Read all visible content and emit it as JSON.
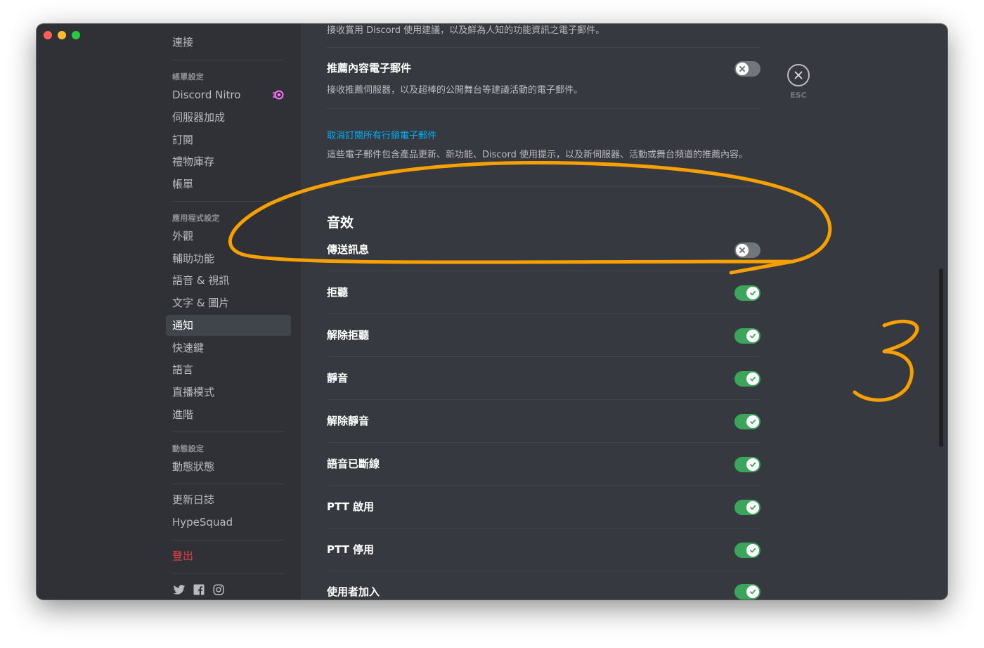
{
  "sidebar": {
    "items": [
      {
        "id": "connections",
        "label": "連接"
      },
      {
        "id": "nitro",
        "label": "Discord Nitro"
      },
      {
        "id": "server-boost",
        "label": "伺服器加成"
      },
      {
        "id": "subscriptions",
        "label": "訂閱"
      },
      {
        "id": "gift-inventory",
        "label": "禮物庫存"
      },
      {
        "id": "billing",
        "label": "帳單"
      },
      {
        "id": "appearance",
        "label": "外觀"
      },
      {
        "id": "accessibility",
        "label": "輔助功能"
      },
      {
        "id": "voice-video",
        "label": "語音 & 視訊"
      },
      {
        "id": "text-images",
        "label": "文字 & 圖片"
      },
      {
        "id": "notifications",
        "label": "通知"
      },
      {
        "id": "keybinds",
        "label": "快速鍵"
      },
      {
        "id": "language",
        "label": "語言"
      },
      {
        "id": "streamer-mode",
        "label": "直播模式"
      },
      {
        "id": "advanced",
        "label": "進階"
      },
      {
        "id": "activity-status",
        "label": "動態狀態"
      },
      {
        "id": "changelog",
        "label": "更新日誌"
      },
      {
        "id": "hypesquad",
        "label": "HypeSquad"
      },
      {
        "id": "logout",
        "label": "登出"
      }
    ],
    "headers": {
      "billing": "帳單設定",
      "app": "應用程式設定",
      "activity": "動態設定"
    },
    "selected": "notifications",
    "social_icons": [
      "twitter-icon",
      "facebook-icon",
      "instagram-icon"
    ]
  },
  "content": {
    "top_text": "接收賞用 Discord 使用建議，以及鮮為人知的功能資訊之電子郵件。",
    "recommendation": {
      "title": "推薦內容電子郵件",
      "desc": "接收推薦伺服器，以及超棒的公開舞台等建議活動的電子郵件。",
      "enabled": false
    },
    "unsubscribe": {
      "link": "取消訂閱所有行銷電子郵件",
      "desc": "這些電子郵件包含產品更新、新功能、Discord 使用提示，以及新伺服器、活動或舞台頻道的推薦內容。"
    },
    "sound_section": {
      "title": "音效",
      "items": [
        {
          "label": "傳送訊息",
          "enabled": false
        },
        {
          "label": "拒聽",
          "enabled": true
        },
        {
          "label": "解除拒聽",
          "enabled": true
        },
        {
          "label": "靜音",
          "enabled": true
        },
        {
          "label": "解除靜音",
          "enabled": true
        },
        {
          "label": "語音已斷線",
          "enabled": true
        },
        {
          "label": "PTT 啟用",
          "enabled": true
        },
        {
          "label": "PTT 停用",
          "enabled": true
        },
        {
          "label": "使用者加入",
          "enabled": true
        }
      ]
    }
  },
  "close": {
    "label": "ESC"
  },
  "annotation": {
    "number_mark": "3",
    "color": "#f7a000"
  },
  "colors": {
    "window_bg": "#36393f",
    "sidebar_bg": "#2f3136",
    "toggle_on": "#3ba55c",
    "toggle_off": "#72767d",
    "link": "#00aff4",
    "danger": "#ed4245"
  }
}
